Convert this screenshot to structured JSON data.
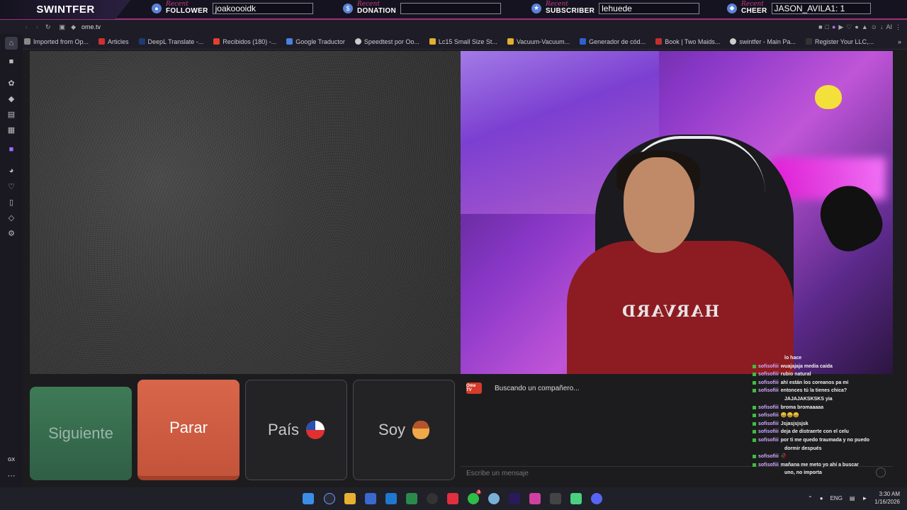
{
  "overlay": {
    "brand": "SWINTFER",
    "recent_label": "Recent",
    "groups": [
      {
        "kind": "FOLLOWER",
        "value": "joakoooidk"
      },
      {
        "kind": "DONATION",
        "value": ""
      },
      {
        "kind": "SUBSCRIBER",
        "value": "lehuede"
      },
      {
        "kind": "CHEER",
        "value": "JASON_AVILA1: 1"
      }
    ]
  },
  "browser": {
    "url": "ome.tv",
    "bookmarks": [
      "Imported from Op...",
      "Articles",
      "DeepL Translate -...",
      "Recibidos (180) -...",
      "Google Traductor",
      "Speedtest por Oo...",
      "Lc15 Small Size St...",
      "Vacuum-Vacuum...",
      "Generador de cód...",
      "Book | Two Maids...",
      "swintfer - Main Pa...",
      "Register Your LLC,..."
    ],
    "toolbar_right": "AI",
    "sidebar_bottom_label": "GX"
  },
  "buttons": {
    "next": "Siguiente",
    "stop": "Parar",
    "country": "País",
    "soy": "Soy"
  },
  "status": {
    "logo_text": "Ome TV",
    "text": "Buscando un compañero..."
  },
  "message_input": {
    "placeholder": "Escribe un mensaje"
  },
  "webcam": {
    "shirt_text": "HARVARD"
  },
  "chat": [
    {
      "user": "",
      "msg": "lo hace"
    },
    {
      "user": "sofisofiii",
      "msg": "wuajajaja media caida"
    },
    {
      "user": "sofisofiii",
      "msg": "rubio natural"
    },
    {
      "user": "sofisofiii",
      "msg": "ahí están los coreanos pa mi"
    },
    {
      "user": "sofisofiii",
      "msg": "entonces tú la tienes chica?"
    },
    {
      "user": "",
      "msg": "JAJAJAKSKSKS yia"
    },
    {
      "user": "sofisofiii",
      "msg": "broma bromaaaaa"
    },
    {
      "user": "sofisofiii",
      "msg": "😄😄😄"
    },
    {
      "user": "sofisofiii",
      "msg": "Jsjasjsjsjsk"
    },
    {
      "user": "sofisofiii",
      "msg": "deja de distraerte con el celu"
    },
    {
      "user": "sofisofiii",
      "msg": "por ti me quedo traumada y no puedo"
    },
    {
      "user": "",
      "msg": "dormir después"
    },
    {
      "user": "sofisofiii",
      "msg": "🥀"
    },
    {
      "user": "sofisofiii",
      "msg": "mañana me meto yo ahí a buscar"
    },
    {
      "user": "",
      "msg": "uno, no importa"
    }
  ],
  "taskbar": {
    "lang": "ENG",
    "time": "3:30 AM",
    "date": "1/16/2026",
    "whatsapp_badge": "3"
  },
  "colors": {
    "next": "#3f7a57",
    "stop": "#d8664a",
    "accent": "#a0307a"
  }
}
